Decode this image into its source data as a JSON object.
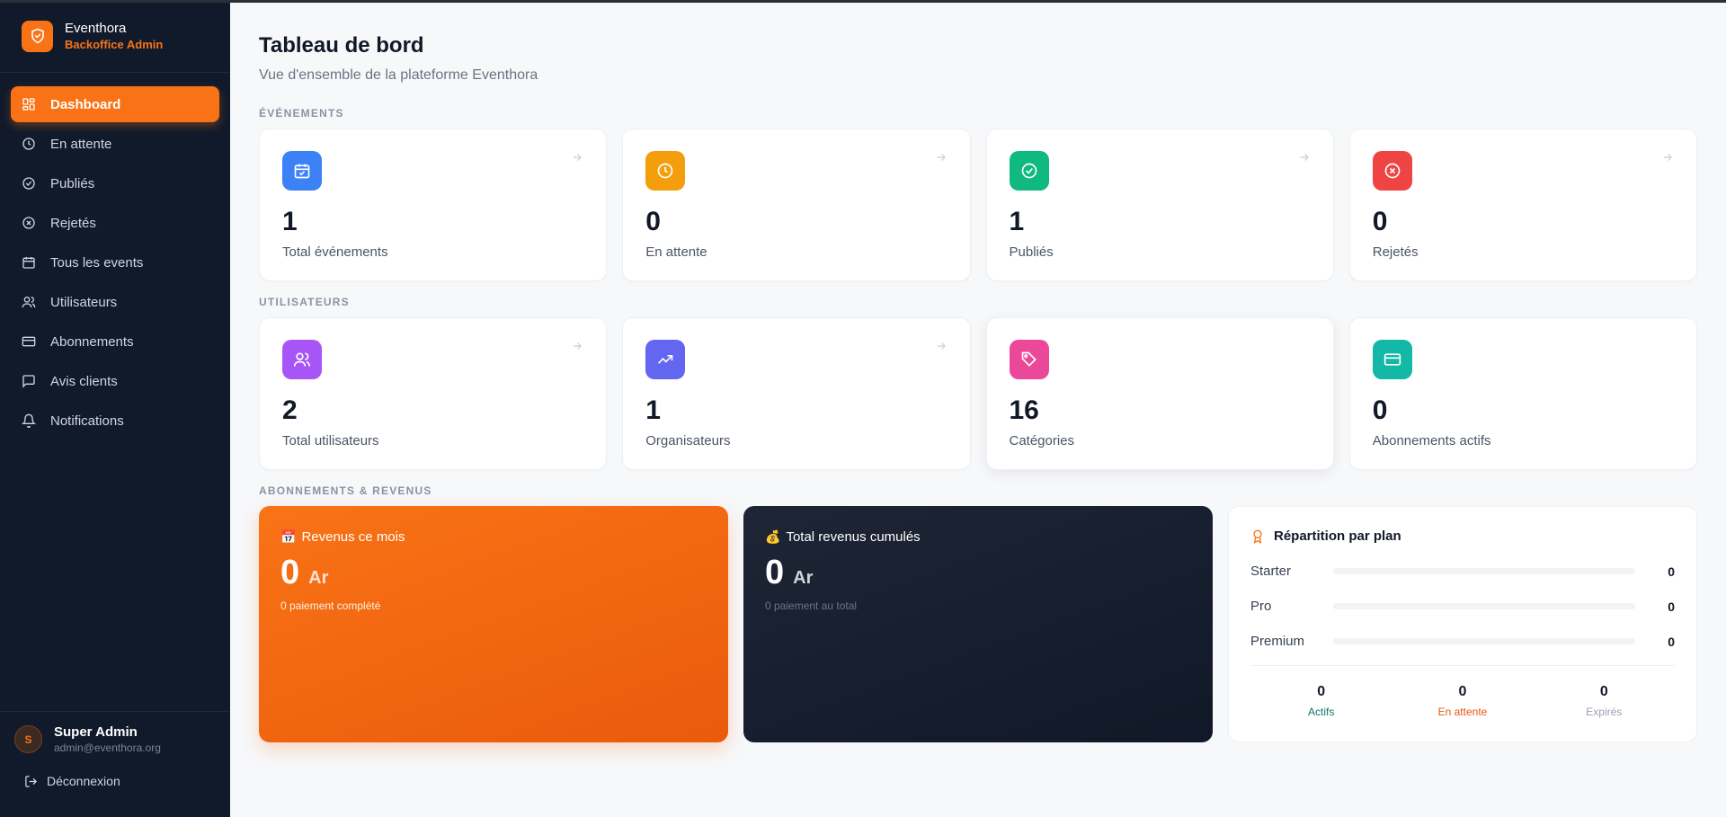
{
  "brand": {
    "name": "Eventhora",
    "subtitle": "Backoffice Admin"
  },
  "nav": [
    {
      "label": "Dashboard",
      "icon": "dashboard-icon",
      "active": true
    },
    {
      "label": "En attente",
      "icon": "clock-icon"
    },
    {
      "label": "Publiés",
      "icon": "check-circle-icon"
    },
    {
      "label": "Rejetés",
      "icon": "x-circle-icon"
    },
    {
      "label": "Tous les events",
      "icon": "calendar-icon"
    },
    {
      "label": "Utilisateurs",
      "icon": "users-icon"
    },
    {
      "label": "Abonnements",
      "icon": "credit-card-icon"
    },
    {
      "label": "Avis clients",
      "icon": "message-icon"
    },
    {
      "label": "Notifications",
      "icon": "bell-icon"
    }
  ],
  "user": {
    "initial": "S",
    "name": "Super Admin",
    "email": "admin@eventhora.org",
    "logout_label": "Déconnexion"
  },
  "header": {
    "title": "Tableau de bord",
    "subtitle": "Vue d'ensemble de la plateforme Eventhora"
  },
  "sections": {
    "events": {
      "label": "ÉVÉNEMENTS",
      "cards": [
        {
          "value": "1",
          "label": "Total événements",
          "icon": "calendar-check-icon",
          "color": "#3b82f6"
        },
        {
          "value": "0",
          "label": "En attente",
          "icon": "clock-icon",
          "color": "#f59e0b"
        },
        {
          "value": "1",
          "label": "Publiés",
          "icon": "check-circle-icon",
          "color": "#10b981"
        },
        {
          "value": "0",
          "label": "Rejetés",
          "icon": "x-circle-icon",
          "color": "#ef4444"
        }
      ]
    },
    "users": {
      "label": "UTILISATEURS",
      "cards": [
        {
          "value": "2",
          "label": "Total utilisateurs",
          "icon": "users-icon",
          "color": "#a855f7"
        },
        {
          "value": "1",
          "label": "Organisateurs",
          "icon": "trending-up-icon",
          "color": "#6366f1"
        },
        {
          "value": "16",
          "label": "Catégories",
          "icon": "tag-icon",
          "color": "#ec4899"
        },
        {
          "value": "0",
          "label": "Abonnements actifs",
          "icon": "credit-card-icon",
          "color": "#14b8a6"
        }
      ]
    },
    "revenue": {
      "label": "ABONNEMENTS & REVENUS",
      "month": {
        "emoji": "📅",
        "title": "Revenus ce mois",
        "value": "0",
        "currency": "Ar",
        "note": "0 paiement complété"
      },
      "total": {
        "emoji": "💰",
        "title": "Total revenus cumulés",
        "value": "0",
        "currency": "Ar",
        "note": "0 paiement au total"
      },
      "plans": {
        "title": "Répartition par plan",
        "icon": "award-icon",
        "rows": [
          {
            "name": "Starter",
            "count": "0",
            "fill": 0
          },
          {
            "name": "Pro",
            "count": "0",
            "fill": 0
          },
          {
            "name": "Premium",
            "count": "0",
            "fill": 0
          }
        ],
        "stats": [
          {
            "value": "0",
            "label": "Actifs",
            "color": "#0f766e"
          },
          {
            "value": "0",
            "label": "En attente",
            "color": "#ea580c"
          },
          {
            "value": "0",
            "label": "Expirés",
            "color": "#9ca3af"
          }
        ]
      }
    }
  },
  "colors": {
    "accent": "#f97316",
    "sidebar": "#111a2b"
  }
}
